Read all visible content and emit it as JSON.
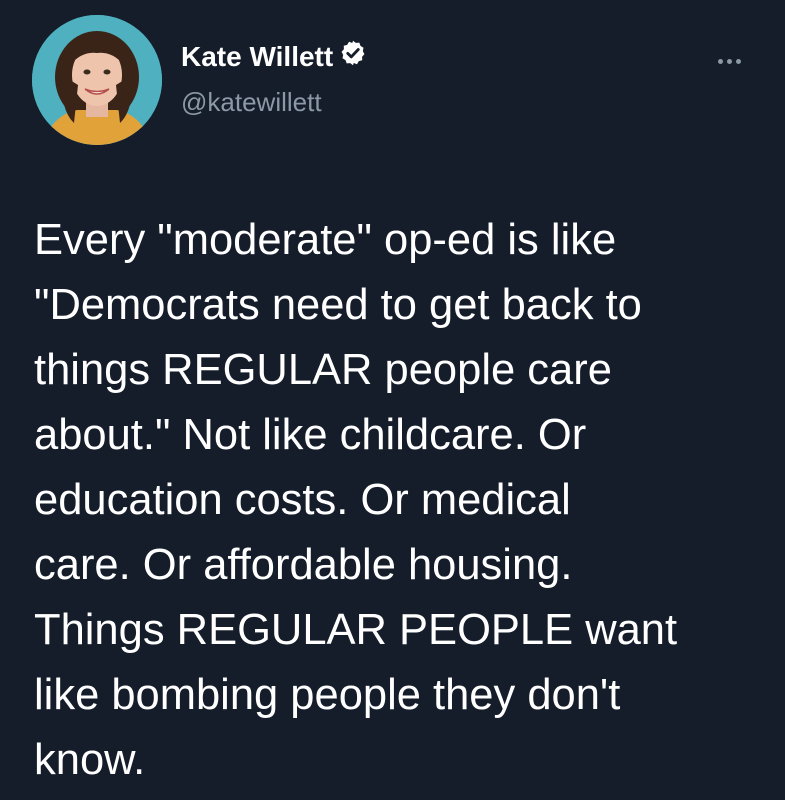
{
  "author": {
    "display_name": "Kate Willett",
    "handle": "@katewillett",
    "verified_icon": "verified-badge-icon",
    "avatar_icon": "avatar"
  },
  "menu": {
    "more_icon": "more-options-icon"
  },
  "tweet": {
    "lines": [
      "Every \"moderate\" op-ed is like",
      "\"Democrats need to get back to",
      "things REGULAR people care",
      "about.\" Not like childcare. Or",
      "education costs. Or medical",
      "care. Or affordable housing.",
      "Things REGULAR PEOPLE want",
      "like bombing people they don't",
      "know."
    ]
  },
  "colors": {
    "background": "#151d2b",
    "text": "#ffffff",
    "secondary_text": "#8b98a5",
    "avatar_ring": "#4fb0bf"
  }
}
